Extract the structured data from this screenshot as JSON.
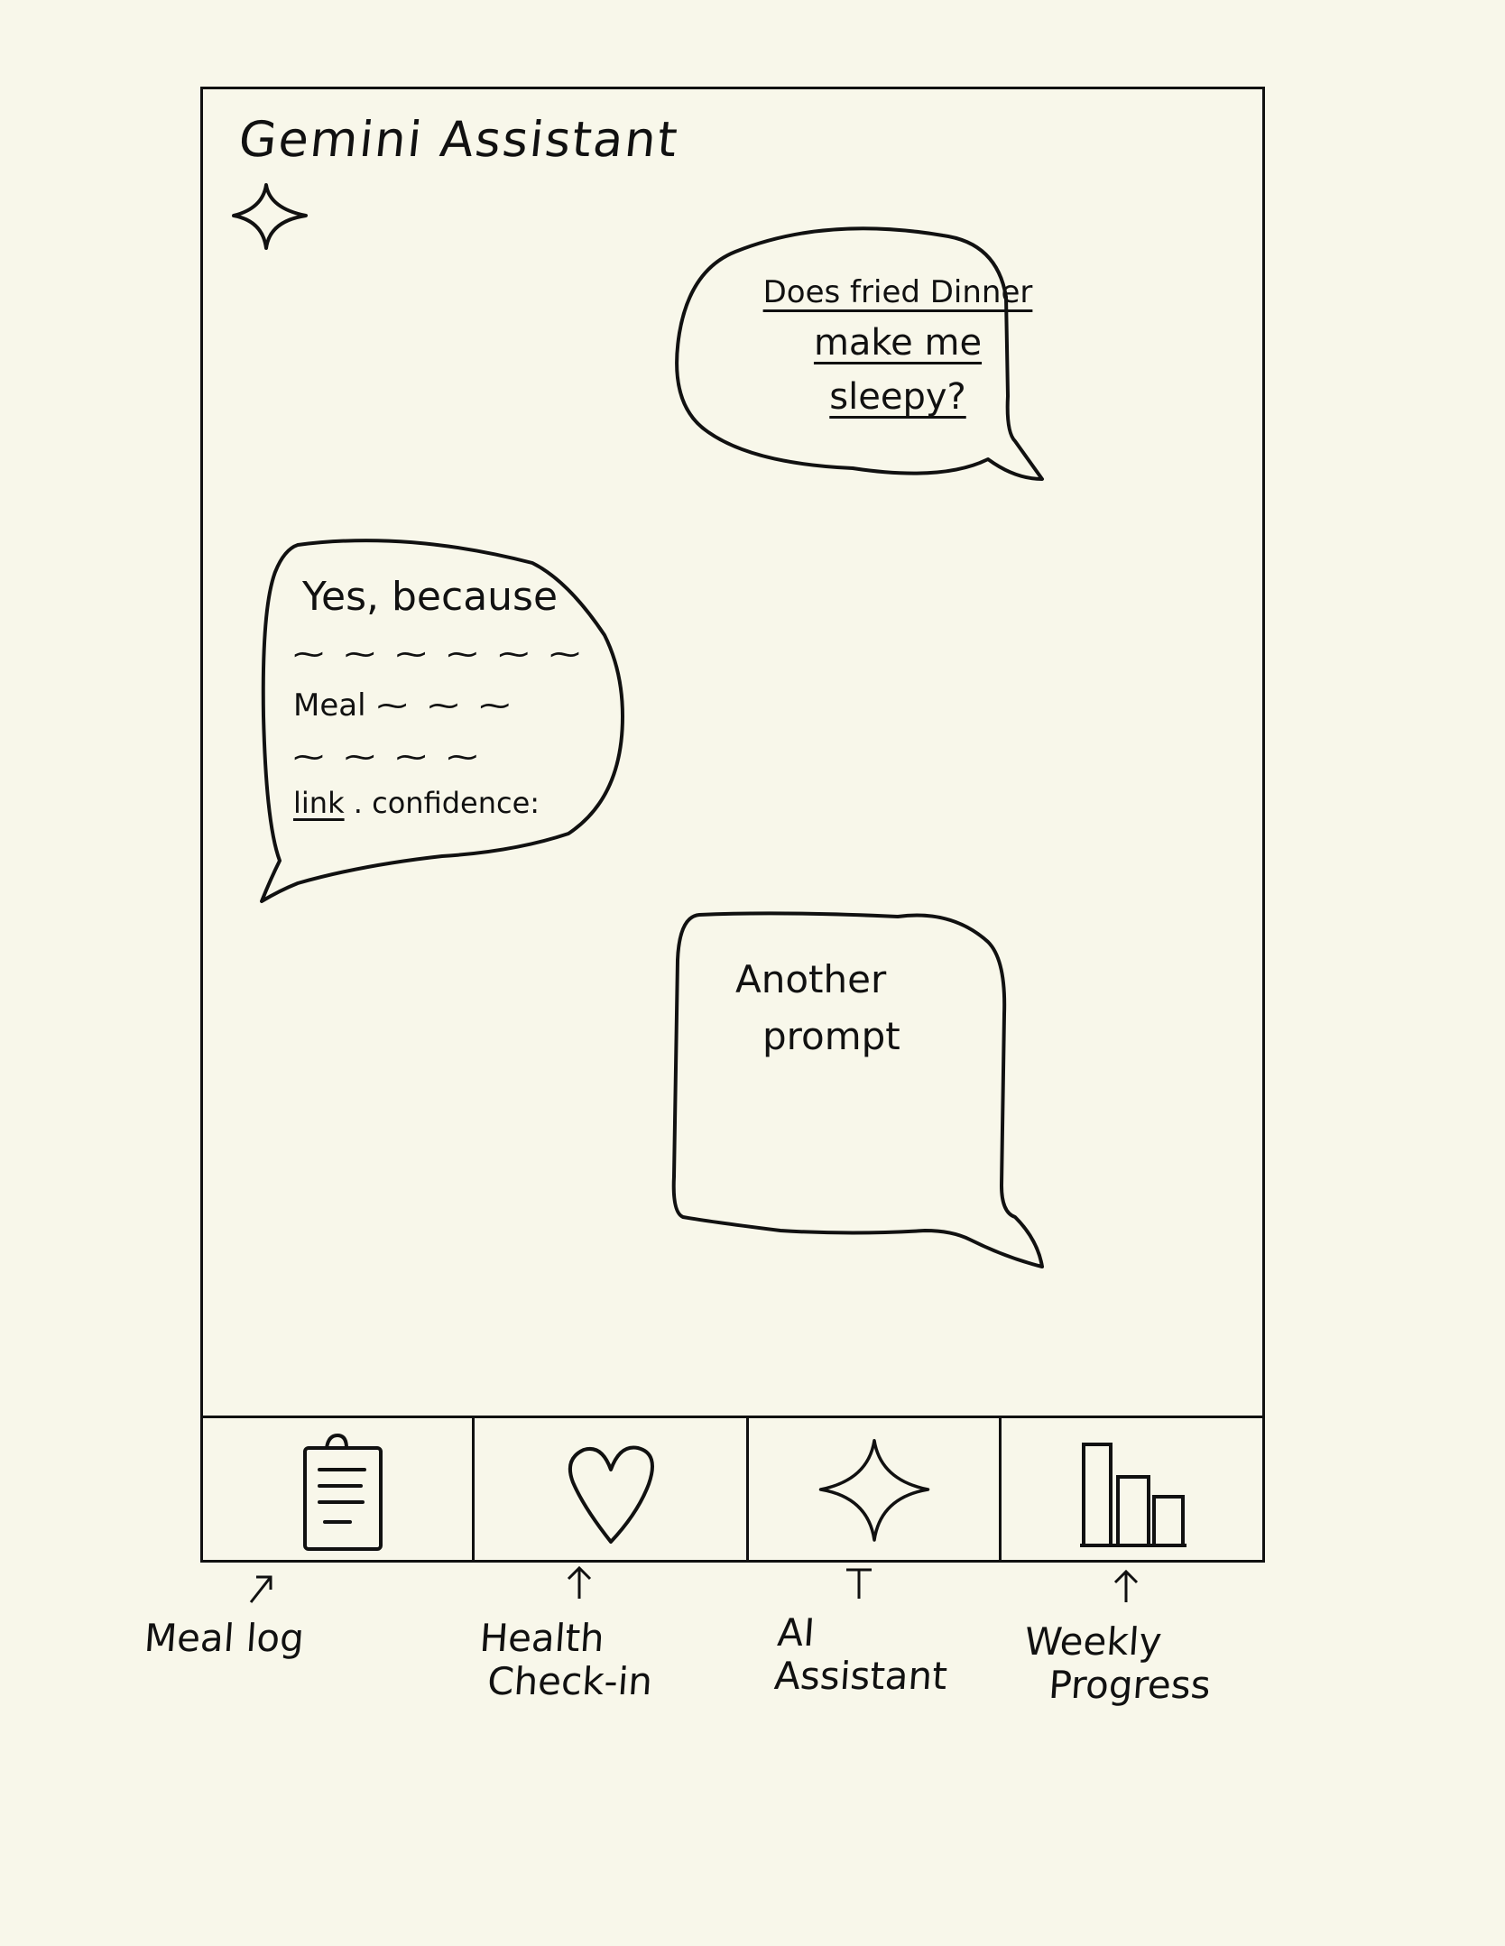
{
  "header": {
    "title": "Gemini Assistant",
    "icon": "sparkle-icon"
  },
  "chat": {
    "user_message_1": {
      "line1": "Does fried Dinner",
      "line2": "make me sleepy?"
    },
    "assistant_reply": {
      "line1": "Yes, because",
      "line2_word": "Meal",
      "link_label": "link",
      "confidence_label": "confidence:"
    },
    "user_message_2": {
      "line1": "Another",
      "line2": "prompt"
    }
  },
  "tab_bar": {
    "tabs": [
      {
        "icon": "clipboard-icon",
        "annotation": "Meal log"
      },
      {
        "icon": "heart-icon",
        "annotation": "Health Check-in"
      },
      {
        "icon": "sparkle-icon",
        "annotation": "AI Assistant"
      },
      {
        "icon": "bar-chart-icon",
        "annotation": "Weekly Progress"
      }
    ]
  },
  "annotations": {
    "meal_log": "Meal log",
    "health_line1": "Health",
    "health_line2": "Check-in",
    "ai_line1": "AI",
    "ai_line2": "Assistant",
    "weekly_line1": "Weekly",
    "weekly_line2": "Progress"
  }
}
